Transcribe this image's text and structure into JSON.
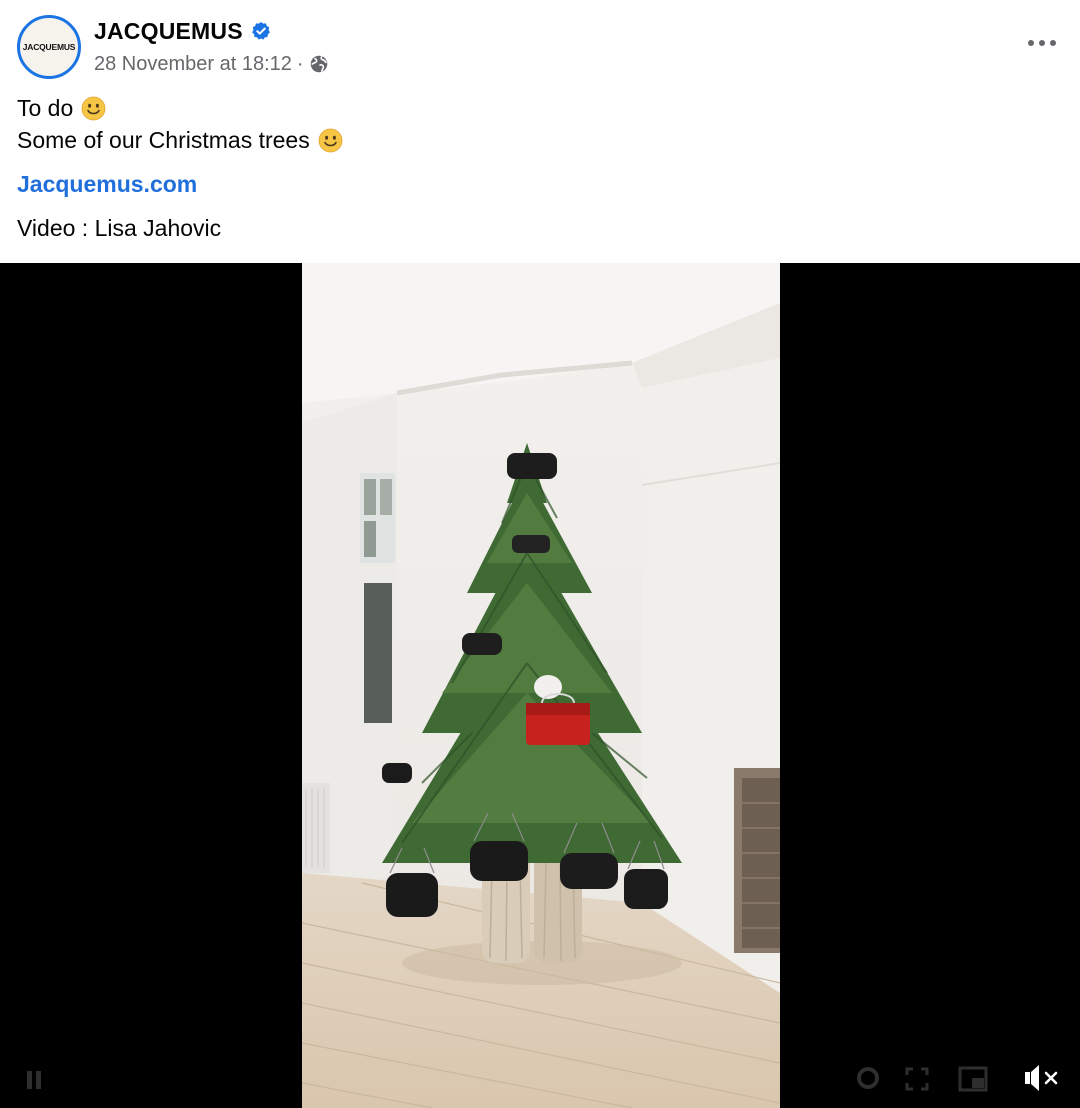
{
  "post": {
    "page_name": "JACQUEMUS",
    "avatar_text": "JACQUEMUS",
    "timestamp": "28 November at 18:12",
    "separator": "·",
    "icons": {
      "verified": "verified-badge-icon",
      "privacy": "globe-icon",
      "more": "more-options-icon",
      "volume": "volume-muted-icon"
    },
    "colors": {
      "accent": "#1b74e4",
      "link": "#216fdb",
      "meta": "#65676b",
      "text": "#050505"
    },
    "message": {
      "line1": "To do",
      "line2": "Some of our Christmas trees",
      "link": "Jacquemus.com",
      "credit": "Video : Lisa Jahovic"
    }
  },
  "video": {
    "muted": true
  }
}
